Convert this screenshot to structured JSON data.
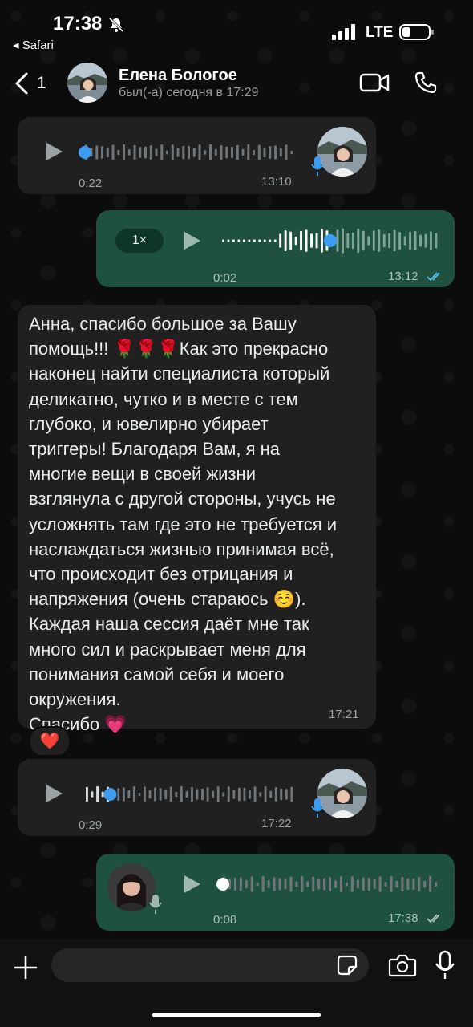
{
  "status_bar": {
    "time": "17:38",
    "back_app": "◂ Safari",
    "network": "LTE"
  },
  "header": {
    "back_count": "1",
    "contact_name": "Елена Бологое",
    "last_seen": "был(-а) сегодня в 17:29",
    "icons": [
      "chevron-left-icon",
      "video-call-icon",
      "phone-icon"
    ]
  },
  "messages": [
    {
      "type": "voice",
      "direction": "incoming",
      "duration": "0:22",
      "time": "13:10",
      "progress": 0.0
    },
    {
      "type": "voice",
      "direction": "outgoing",
      "speed": "1×",
      "duration": "0:02",
      "time": "13:12",
      "status": "read",
      "progress": 0.5
    },
    {
      "type": "text",
      "direction": "incoming",
      "text": "Анна, спасибо  большое за Вашу\nпомощь!!! 🌹🌹🌹Как это прекрасно\nнаконец найти специалиста который\nделикатно, чутко и в месте с тем\nглубоко, и ювелирно убирает\nтриггеры! Благодаря Вам, я на\nмногие вещи в своей жизни\nвзглянула с другой стороны, учусь не\nусложнять там где это не требуется и\nнаслаждаться жизнью принимая всё,\nчто происходит без отрицания и\nнапряжения (очень стараюсь ☺️).\nКаждая наша сессия даёт мне так\nмного сил и раскрывает меня для\nпонимания самой себя и моего\nокружения.\nСпасибо 💗",
      "time": "17:21",
      "reaction": "❤️"
    },
    {
      "type": "voice",
      "direction": "incoming",
      "duration": "0:29",
      "time": "17:22",
      "progress": 0.12
    },
    {
      "type": "voice",
      "direction": "outgoing",
      "duration": "0:08",
      "time": "17:38",
      "status": "delivered",
      "progress": 0.0
    }
  ],
  "input": {
    "placeholder": "",
    "icons": [
      "plus-icon",
      "sticker-icon",
      "camera-icon",
      "microphone-icon"
    ]
  },
  "colors": {
    "background": "#0c0c0c",
    "incoming_bubble": "#202020",
    "outgoing_bubble": "#1e5140",
    "accent_blue": "#3b9cf2",
    "read_ticks": "#53bdeb"
  }
}
